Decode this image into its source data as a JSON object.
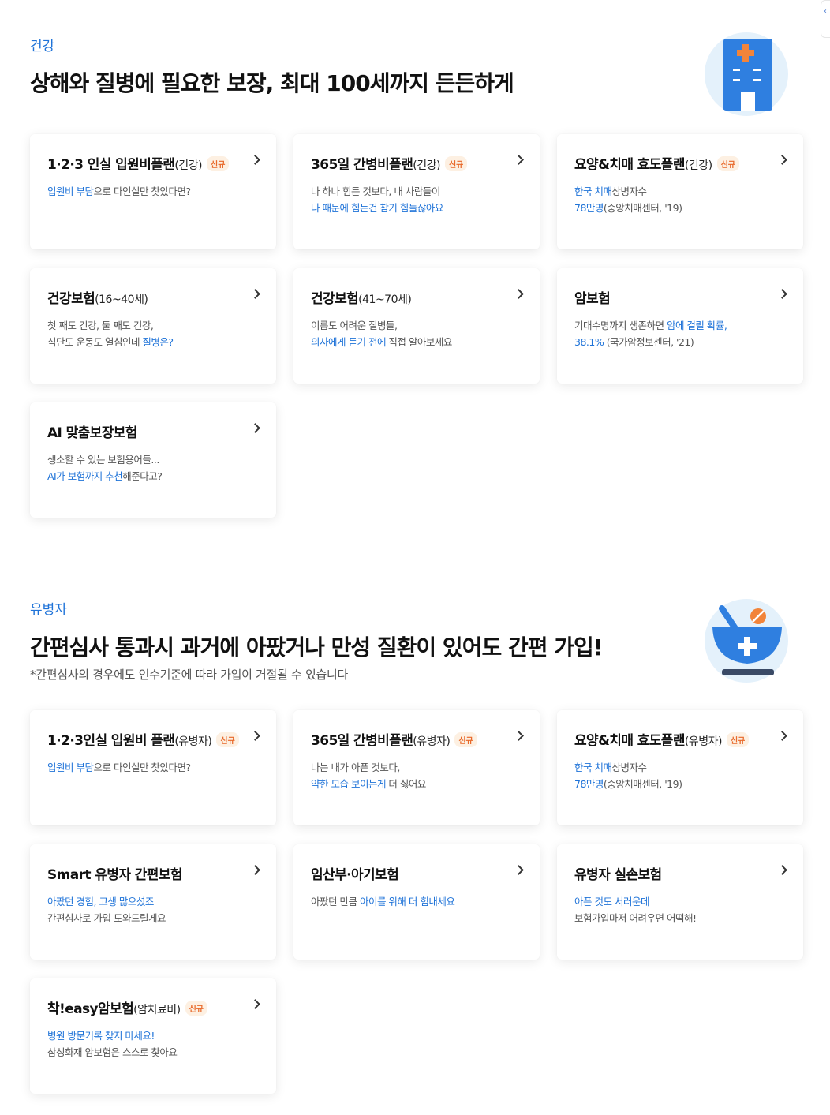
{
  "colors": {
    "accent": "#1f73d8",
    "badge_text": "#e8692a",
    "badge_bg": "#fdf0e2",
    "illustration_bg": "#e4f1fb"
  },
  "health": {
    "eyebrow": "건강",
    "headline": "상해와 질병에 필요한 보장, 최대 100세까지 든든하게",
    "icon": "hospital-building-icon",
    "cards": [
      {
        "title": "1·2·3 인실 입원비플랜",
        "sub": "(건강)",
        "badge": "신규",
        "line1": [
          {
            "t": "입원비 부담",
            "hl": true
          },
          {
            "t": "으로 다인실만 찾았다면?",
            "hl": false
          }
        ],
        "line2": []
      },
      {
        "title": "365일 간병비플랜",
        "sub": "(건강)",
        "badge": "신규",
        "line1": [
          {
            "t": "나 하나 힘든 것보다, 내 사람들이",
            "hl": false
          }
        ],
        "line2": [
          {
            "t": "나 때문에 힘든건 참기 힘들잖아요",
            "hl": true
          }
        ]
      },
      {
        "title": "요양&치매 효도플랜",
        "sub": "(건강)",
        "badge": "신규",
        "line1": [
          {
            "t": "한국 치매",
            "hl": true
          },
          {
            "t": "상병자수",
            "hl": false
          }
        ],
        "line2": [
          {
            "t": "78만명",
            "hl": true
          },
          {
            "t": "(중앙치매센터, '19)",
            "hl": false
          }
        ]
      },
      {
        "title": "건강보험",
        "sub": "(16~40세)",
        "badge": "",
        "line1": [
          {
            "t": "첫 째도 건강, 둘 째도 건강,",
            "hl": false
          }
        ],
        "line2": [
          {
            "t": "식단도 운동도 열심인데 ",
            "hl": false
          },
          {
            "t": "질병은?",
            "hl": true
          }
        ]
      },
      {
        "title": "건강보험",
        "sub": "(41~70세)",
        "badge": "",
        "line1": [
          {
            "t": "이름도 어려운 질병들,",
            "hl": false
          }
        ],
        "line2": [
          {
            "t": "의사에게 듣기 전에",
            "hl": true
          },
          {
            "t": " 직접 알아보세요",
            "hl": false
          }
        ]
      },
      {
        "title": "암보험",
        "sub": "",
        "badge": "",
        "line1": [
          {
            "t": "기대수명까지 생존하면 ",
            "hl": false
          },
          {
            "t": "암에 걸릴 확률,",
            "hl": true
          }
        ],
        "line2": [
          {
            "t": "38.1%",
            "hl": true
          },
          {
            "t": " (국가암정보센터, '21)",
            "hl": false
          }
        ]
      },
      {
        "title": "AI 맞춤보장보험",
        "sub": "",
        "badge": "",
        "line1": [
          {
            "t": "생소할 수 있는 보험용어들...",
            "hl": false
          }
        ],
        "line2": [
          {
            "t": "AI가 보험까지 추천",
            "hl": true
          },
          {
            "t": "해준다고?",
            "hl": false
          }
        ]
      }
    ]
  },
  "prior": {
    "eyebrow": "유병자",
    "headline": "간편심사 통과시 과거에 아팠거나 만성 질환이 있어도 간편 가입!",
    "note": "*간편심사의 경우에도 인수기준에 따라 가입이 거절될 수 있습니다",
    "icon": "medicine-bowl-icon",
    "cards": [
      {
        "title": "1·2·3인실 입원비 플랜",
        "sub": "(유병자)",
        "badge": "신규",
        "line1": [
          {
            "t": "입원비 부담",
            "hl": true
          },
          {
            "t": "으로 다인실만 찾았다면?",
            "hl": false
          }
        ],
        "line2": []
      },
      {
        "title": "365일 간병비플랜",
        "sub": "(유병자)",
        "badge": "신규",
        "line1": [
          {
            "t": "나는 내가 아픈 것보다,",
            "hl": false
          }
        ],
        "line2": [
          {
            "t": "약한 모습 보이는게",
            "hl": true
          },
          {
            "t": " 더 싫어요",
            "hl": false
          }
        ]
      },
      {
        "title": "요양&치매 효도플랜",
        "sub": "(유병자)",
        "badge": "신규",
        "line1": [
          {
            "t": "한국 치매",
            "hl": true
          },
          {
            "t": "상병자수",
            "hl": false
          }
        ],
        "line2": [
          {
            "t": "78만명",
            "hl": true
          },
          {
            "t": "(중앙치매센터, '19)",
            "hl": false
          }
        ]
      },
      {
        "title": "Smart 유병자 간편보험",
        "sub": "",
        "badge": "",
        "line1": [
          {
            "t": "아팠던 경험, 고생 많으셨죠",
            "hl": true
          }
        ],
        "line2": [
          {
            "t": "간편심사로 가입 도와드릴게요",
            "hl": false
          }
        ]
      },
      {
        "title": "임산부·아기보험",
        "sub": "",
        "badge": "",
        "line1": [
          {
            "t": "아팠던 만큼 ",
            "hl": false
          },
          {
            "t": "아이를 위해 더 힘내세요",
            "hl": true
          }
        ],
        "line2": []
      },
      {
        "title": "유병자 실손보험",
        "sub": "",
        "badge": "",
        "line1": [
          {
            "t": "아픈 것도 서러운데",
            "hl": true
          }
        ],
        "line2": [
          {
            "t": "보험가입마저 어려우면 어떡해!",
            "hl": false
          }
        ]
      },
      {
        "title": "착!easy암보험",
        "sub": "(암치료비)",
        "badge": "신규",
        "line1": [
          {
            "t": "병원 방문기록 찾지 마세요!",
            "hl": true
          }
        ],
        "line2": [
          {
            "t": "삼성화재 암보험은 스스로 찾아요",
            "hl": false
          }
        ]
      }
    ]
  }
}
